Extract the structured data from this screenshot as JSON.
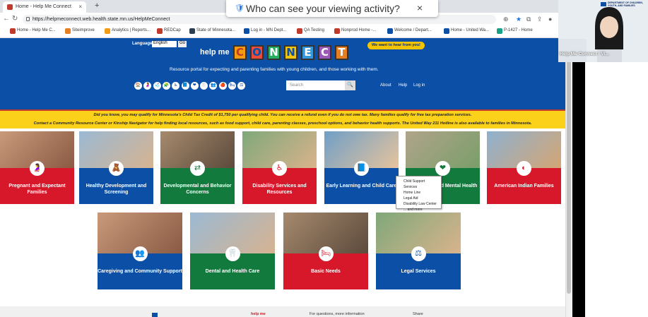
{
  "browser": {
    "tab_title": "Home - Help Me Connect",
    "new_tab": "+",
    "url": "https://helpmeconnect.web.health.state.mn.us/HelpMeConnect",
    "bookmarks": [
      "Home - Help Me C...",
      "Siteimprove",
      "Analytics | Reports...",
      "REDCap",
      "State of Minnesota...",
      "Log in - MN Dept...",
      "QA Testing",
      "Nonprod Home -...",
      "Welcome / Depart...",
      "Home - United Wa...",
      "P-1427 - Home"
    ]
  },
  "toast": {
    "text": "Who can see your viewing activity?",
    "close": "×"
  },
  "video": {
    "participant": "Help Me Connect - Vi...",
    "org": "DEPARTMENT OF CHILDREN, YOUTH, AND FAMILIES"
  },
  "site": {
    "language_label": "Language",
    "language_value": "English",
    "language_go": "Go",
    "help_me": "help me",
    "connect_letters": [
      "C",
      "O",
      "N",
      "N",
      "E",
      "C",
      "T"
    ],
    "hear_button": "We want to hear from you!",
    "tagline": "Resource portal for expecting and parenting families with young children, and those working with them.",
    "search_placeholder": "Search",
    "header_links": [
      "About",
      "Help",
      "Log in"
    ],
    "category_icons": [
      "🏠",
      "🤰",
      "🩺",
      "🧩",
      "♿",
      "📘",
      "❤",
      "🦷",
      "👥",
      "🍎",
      "🛏",
      "⚖"
    ],
    "banner_line1": "Did you know, you may qualify for Minnesota's Child Tax Credit of $1,750 per qualifying child. You can receive a refund even if you do not owe tax. Many families qualify for free tax preparation services.",
    "banner_line2": "Contact a Community Resource Center or Kinship Navigator for help finding local resources, such as food support, child care, parenting classes, preschool options, and behavior health supports. The United Way 211 Hotline is also available to families in Minnesota.",
    "tiles_row1": [
      {
        "label": "Pregnant and Expectant Families",
        "color": "#d7182a",
        "icon": "🤰"
      },
      {
        "label": "Healthy Development and Screening",
        "color": "#0b4fa6",
        "icon": "🧸"
      },
      {
        "label": "Developmental and Behavior Concerns",
        "color": "#127a3c",
        "icon": "⇄"
      },
      {
        "label": "Disability Services and Resources",
        "color": "#d7182a",
        "icon": "♿"
      },
      {
        "label": "Early Learning and Child Care",
        "color": "#0b4fa6",
        "icon": "📘"
      },
      {
        "label": "Well-Being and Mental Health",
        "color": "#127a3c",
        "icon": "❤"
      },
      {
        "label": "American Indian Families",
        "color": "#d7182a",
        "icon": "◐"
      }
    ],
    "tiles_row2": [
      {
        "label": "Caregiving and Community Support",
        "color": "#0b4fa6",
        "icon": "👥"
      },
      {
        "label": "Dental and Health Care",
        "color": "#127a3c",
        "icon": "🦷"
      },
      {
        "label": "Basic Needs",
        "color": "#d7182a",
        "icon": "🛏"
      },
      {
        "label": "Legal Services",
        "color": "#0b4fa6",
        "icon": "⚖"
      }
    ],
    "tooltip_items": [
      "Child Support Services",
      "Home Line",
      "Legal Aid",
      "Disability Law Center",
      "... and more"
    ],
    "footer": {
      "contact": "For questions, more information",
      "share": "Share",
      "help_me": "help me"
    }
  }
}
